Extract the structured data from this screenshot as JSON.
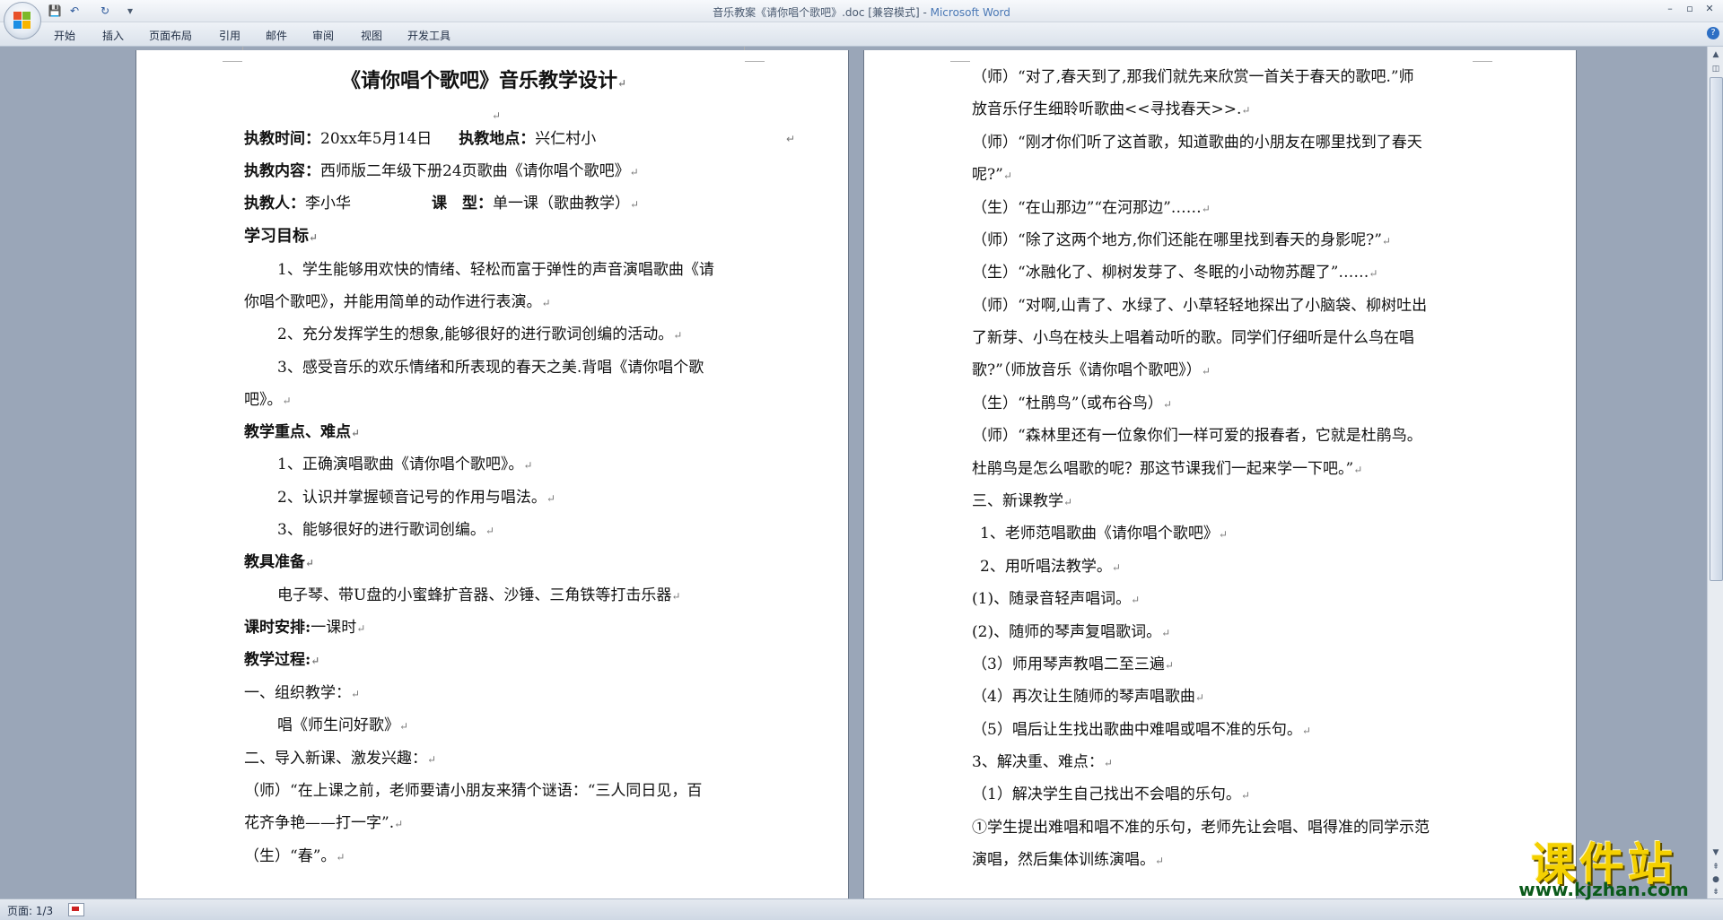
{
  "window": {
    "title_prefix": "音乐教案《请你唱个歌吧》.doc [兼容模式] - ",
    "title_app": "Microsoft Word",
    "minimize_glyph": "–",
    "maximize_glyph": "▫",
    "close_glyph": "✕"
  },
  "quick_access": {
    "save_icon": "💾",
    "undo_icon": "↶",
    "redo_icon": "↻",
    "customize_icon": "▾"
  },
  "ribbon": {
    "tabs": [
      "开始",
      "插入",
      "页面布局",
      "引用",
      "邮件",
      "审阅",
      "视图",
      "开发工具"
    ],
    "help_glyph": "?"
  },
  "page1": {
    "title": "《请你唱个歌吧》音乐教学设计",
    "date_label": "执教时间：",
    "date_value": "20xx年5月14日",
    "place_label": "执教地点：",
    "place_value": "兴仁村小",
    "content_label": "执教内容：",
    "content_value": "西师版二年级下册24页歌曲《请你唱个歌吧》",
    "teacher_label": "执教人：",
    "teacher_value": "李小华",
    "type_label": "课　型：",
    "type_value": "单一课（歌曲教学）",
    "goals_heading": "学习目标",
    "goal1_a": "1、学生能够用欢快的情绪、轻松而富于弹性的声音演唱歌曲《请",
    "goal1_b": "你唱个歌吧》，并能用简单的动作进行表演。",
    "goal2": "2、充分发挥学生的想象,能够很好的进行歌词创编的活动。",
    "goal3_a": "3、感受音乐的欢乐情绪和所表现的春天之美.背唱《请你唱个歌",
    "goal3_b": "吧》。",
    "key_heading": "教学重点、难点",
    "key1": "1、正确演唱歌曲《请你唱个歌吧》。",
    "key2": "2、认识并掌握顿音记号的作用与唱法。",
    "key3": "3、能够很好的进行歌词创编。",
    "tools_heading": "教具准备",
    "tools_text": "电子琴、带U盘的小蜜蜂扩音器、沙锤、三角铁等打击乐器",
    "time_label": "课时安排:",
    "time_value": "一课时",
    "process_heading": "教学过程:",
    "step1": "一、组织教学：",
    "step1_sub": "唱《师生问好歌》",
    "step2": "二、导入新课、激发兴趣：",
    "riddle_a": "（师）“在上课之前，老师要请小朋友来猜个谜语：“三人同日见，百",
    "riddle_b": "花齐争艳——打一字”.",
    "answer": "（生）“春”。"
  },
  "page2": {
    "l1": "（师）“对了,春天到了,那我们就先来欣赏一首关于春天的歌吧.”师",
    "l2": "放音乐仔生细聆听歌曲<<寻找春天>>.",
    "l3": "（师）“刚才你们听了这首歌，知道歌曲的小朋友在哪里找到了春天",
    "l4": "呢?”",
    "l5": "（生）“在山那边”“在河那边”……",
    "l6": "（师）“除了这两个地方,你们还能在哪里找到春天的身影呢?”",
    "l7": "（生）“冰融化了、柳树发芽了、冬眠的小动物苏醒了”……",
    "l8": "（师）“对啊,山青了、水绿了、小草轻轻地探出了小脑袋、柳树吐出",
    "l9": "了新芽、小鸟在枝头上唱着动听的歌。同学们仔细听是什么鸟在唱",
    "l10": "歌?”（师放音乐《请你唱个歌吧》）",
    "l11": "（生）“杜鹃鸟”（或布谷鸟）",
    "l12": "（师）“森林里还有一位象你们一样可爱的报春者，它就是杜鹃鸟。",
    "l13": "杜鹃鸟是怎么唱歌的呢？那这节课我们一起来学一下吧。”",
    "l14": "三、新课教学",
    "l15": "1、老师范唱歌曲《请你唱个歌吧》",
    "l16": "2、用听唱法教学。",
    "l17": "(1)、随录音轻声唱词。",
    "l18": "(2)、随师的琴声复唱歌词。",
    "l19": "（3）师用琴声教唱二至三遍",
    "l20": "（4）再次让生随师的琴声唱歌曲",
    "l21": "（5）唱后让生找出歌曲中难唱或唱不准的乐句。",
    "l22": "3、解决重、难点：",
    "l23": "（1）解决学生自己找出不会唱的乐句。",
    "l24": "①学生提出难唱和唱不准的乐句，老师先让会唱、唱得准的同学示范",
    "l25": "演唱，然后集体训练演唱。"
  },
  "editor": {
    "paragraph_mark": "↵"
  },
  "statusbar": {
    "page_indicator": "页面: 1/3"
  },
  "watermark": {
    "brand": "课件站",
    "url": "www.kjzhan.com"
  }
}
